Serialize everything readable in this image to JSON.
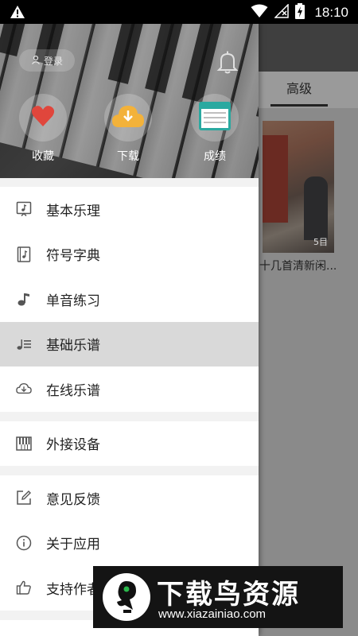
{
  "status_bar": {
    "time": "18:10"
  },
  "background_page": {
    "tab_label": "高级",
    "card_count": "5目",
    "card_title": "十几首清新闲..."
  },
  "drawer": {
    "login_label": "登录",
    "quick_actions": [
      {
        "label": "收藏",
        "icon": "heart-icon"
      },
      {
        "label": "下载",
        "icon": "download-cloud-icon"
      },
      {
        "label": "成绩",
        "icon": "score-card-icon"
      }
    ],
    "menu_groups": [
      [
        {
          "label": "基本乐理",
          "icon": "music-note-icon"
        },
        {
          "label": "符号字典",
          "icon": "music-book-icon"
        },
        {
          "label": "单音练习",
          "icon": "single-note-icon"
        },
        {
          "label": "基础乐谱",
          "icon": "score-list-icon",
          "active": true
        },
        {
          "label": "在线乐谱",
          "icon": "cloud-download-icon"
        }
      ],
      [
        {
          "label": "外接设备",
          "icon": "piano-keys-icon"
        }
      ],
      [
        {
          "label": "意见反馈",
          "icon": "edit-icon"
        },
        {
          "label": "关于应用",
          "icon": "info-icon"
        },
        {
          "label": "支持作者",
          "icon": "thumbs-up-icon"
        }
      ]
    ]
  },
  "watermark": {
    "title": "下载鸟资源",
    "url": "www.xiazainiao.com"
  },
  "colors": {
    "accent_blue": "#33b5e5",
    "heart_red": "#e0463c",
    "download_orange": "#f3b23a",
    "score_teal": "#2aa9a0"
  }
}
